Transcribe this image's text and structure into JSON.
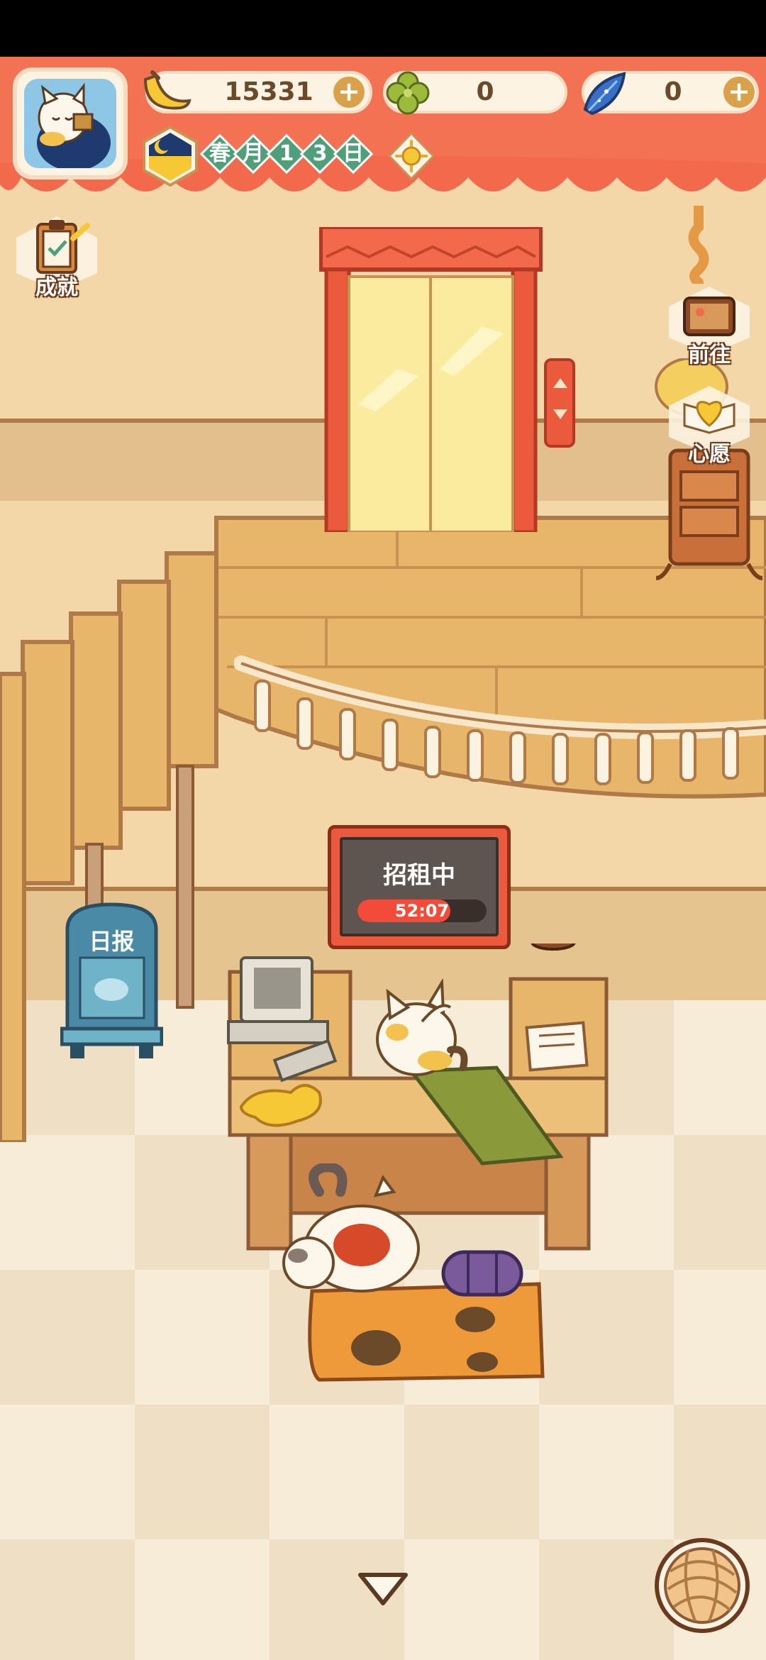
{
  "hud": {
    "bananas": "15331",
    "clovers": "0",
    "gems": "0",
    "date_chars": [
      "春",
      "月",
      "1",
      "3",
      "日"
    ]
  },
  "side_buttons": {
    "achievements": "成就",
    "goto": "前往",
    "wish": "心愿"
  },
  "sign": {
    "title": "招租中",
    "timer": "52:07",
    "progress": 0.72
  },
  "newspaper": {
    "label": "日报"
  },
  "colors": {
    "header": "#f26a4b",
    "wall": "#f4d7a8",
    "floor_light": "#f7ecd8",
    "floor_dark": "#efdfc4",
    "wood": "#e8b66a",
    "accent_green": "#4fa07a"
  },
  "icons": {
    "bananas": "banana-icon",
    "clovers": "clover-icon",
    "gems": "blue-feather-icon",
    "weather": "sun-icon",
    "time": "night-moon-icon"
  }
}
